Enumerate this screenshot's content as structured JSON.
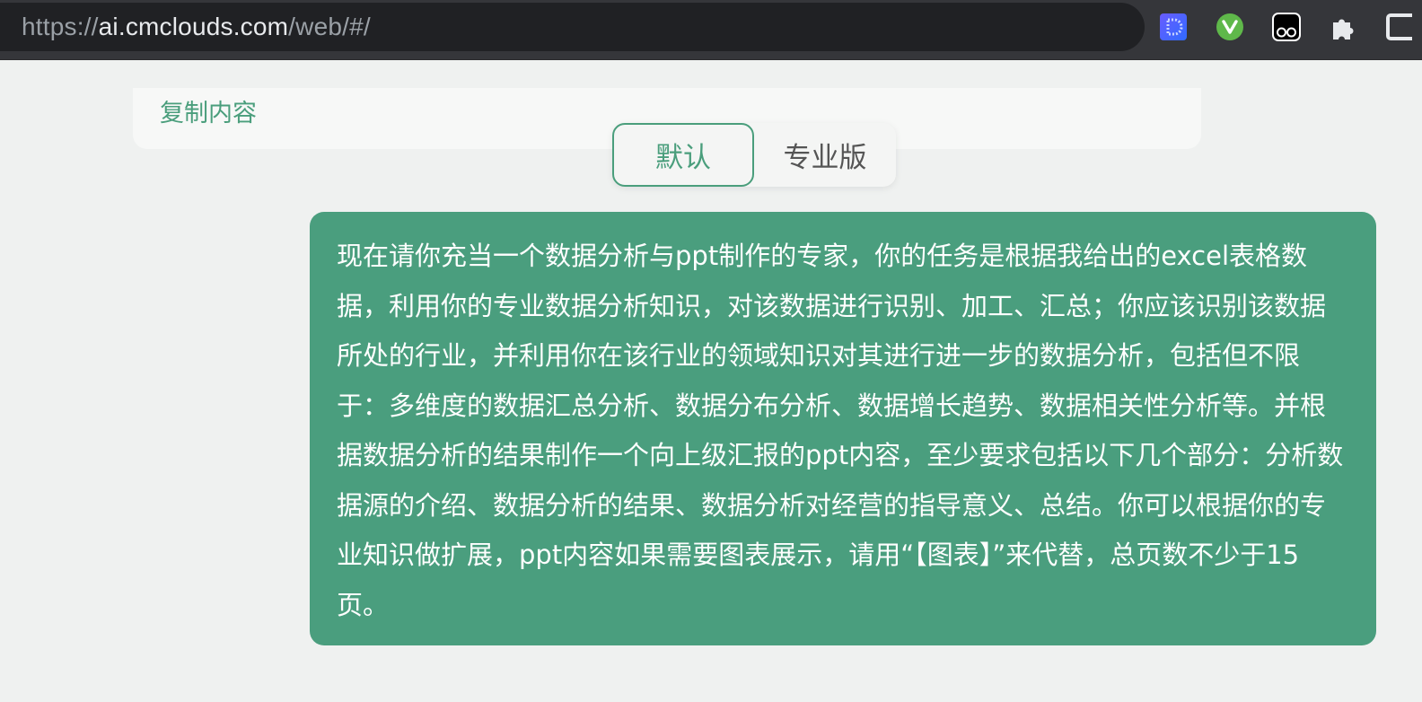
{
  "browser": {
    "url_scheme": "https://",
    "url_host": "ai.cmclouds.com",
    "url_path": "/web/#/",
    "extensions": [
      "dicer-extension-icon",
      "yandex-extension-icon",
      "tampermonkey-extension-icon",
      "puzzle-icon",
      "sidebar-icon"
    ]
  },
  "card": {
    "copy_label": "复制内容"
  },
  "mode_toggle": {
    "options": [
      {
        "label": "默认",
        "active": true
      },
      {
        "label": "专业版",
        "active": false
      }
    ]
  },
  "message": {
    "text": "现在请你充当一个数据分析与ppt制作的专家，你的任务是根据我给出的excel表格数据，利用你的专业数据分析知识，对该数据进行识别、加工、汇总；你应该识别该数据所处的行业，并利用你在该行业的领域知识对其进行进一步的数据分析，包括但不限于：多维度的数据汇总分析、数据分布分析、数据增长趋势、数据相关性分析等。并根据数据分析的结果制作一个向上级汇报的ppt内容，至少要求包括以下几个部分：分析数据源的介绍、数据分析的结果、数据分析对经营的指导意义、总结。你可以根据你的专业知识做扩展，ppt内容如果需要图表展示，请用“【图表】”来代替，总页数不少于15页。"
  },
  "colors": {
    "accent": "#4a9e7c",
    "bubble": "#4a9e7e",
    "page_bg": "#eff1f0"
  }
}
